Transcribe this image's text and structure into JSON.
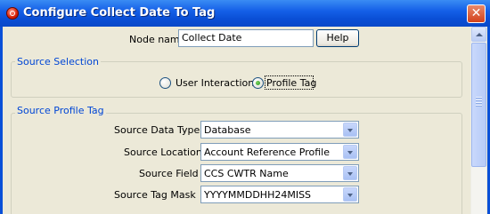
{
  "window": {
    "title": "Configure Collect Date To Tag"
  },
  "node": {
    "label": "Node name",
    "value": "Collect Date",
    "help_label": "Help"
  },
  "source_selection": {
    "title": "Source Selection",
    "options": [
      {
        "label": "User Interaction",
        "checked": false
      },
      {
        "label": "Profile Tag",
        "checked": true
      }
    ]
  },
  "source_profile_tag": {
    "title": "Source Profile Tag",
    "fields": [
      {
        "label": "Source Data Type",
        "value": "Database"
      },
      {
        "label": "Source Location",
        "value": "Account Reference Profile"
      },
      {
        "label": "Source Field",
        "value": "CCS CWTR Name"
      },
      {
        "label": "Source Tag Mask",
        "value": "YYYYMMDDHH24MISS"
      }
    ]
  },
  "icons": {
    "app": "app-icon",
    "close": "close-icon",
    "dropdown": "chevron-down-icon",
    "scroll_up": "scroll-up-arrow-icon"
  }
}
